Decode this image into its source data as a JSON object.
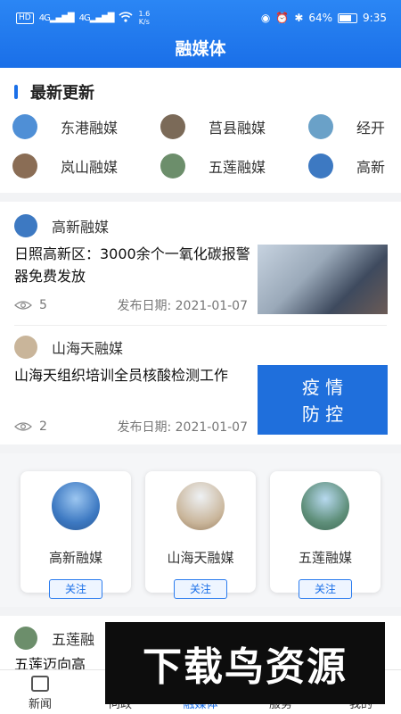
{
  "status_bar": {
    "net_badge": "HD",
    "signal1": "4G",
    "signal2": "4G",
    "speed_value": "1.6",
    "speed_unit": "K/s",
    "battery": "64%",
    "time": "9:35"
  },
  "header": {
    "title": "融媒体"
  },
  "latest": {
    "title": "最新更新",
    "row1": [
      {
        "name": "东港融媒",
        "avatar_color": "#4f8fd6"
      },
      {
        "name": "莒县融媒",
        "avatar_color": "#7b6a58"
      },
      {
        "name": "经开",
        "avatar_color": "#6aa1c8"
      }
    ],
    "row2": [
      {
        "name": "岚山融媒",
        "avatar_color": "#8a6d55"
      },
      {
        "name": "五莲融媒",
        "avatar_color": "#6c8e6b"
      },
      {
        "name": "高新",
        "avatar_color": "#3d79c2"
      }
    ]
  },
  "news": [
    {
      "source": "高新融媒",
      "headline": "日照高新区：3000余个一氧化碳报警器免费发放",
      "views": "5",
      "date": "发布日期: 2021-01-07"
    },
    {
      "source": "山海天融媒",
      "headline": "山海天组织培训全员核酸检测工作",
      "views": "2",
      "date": "发布日期: 2021-01-07",
      "banner_line1": "疫 情",
      "banner_line2": "防 控"
    }
  ],
  "cards": [
    {
      "name": "高新融媒",
      "follow": "关注",
      "avatar_color": "#3d79c2"
    },
    {
      "name": "山海天融媒",
      "follow": "关注",
      "avatar_color": "#c9b59a"
    },
    {
      "name": "五莲融媒",
      "follow": "关注",
      "avatar_color": "#5f8f7a"
    }
  ],
  "partial": {
    "source": "五莲融",
    "headline": "五莲迈向高"
  },
  "bottom_nav": [
    {
      "label": "新闻"
    },
    {
      "label": "问政"
    },
    {
      "label": "融媒体"
    },
    {
      "label": "服务"
    },
    {
      "label": "我的"
    }
  ],
  "watermark": {
    "text": "下载鸟资源"
  }
}
